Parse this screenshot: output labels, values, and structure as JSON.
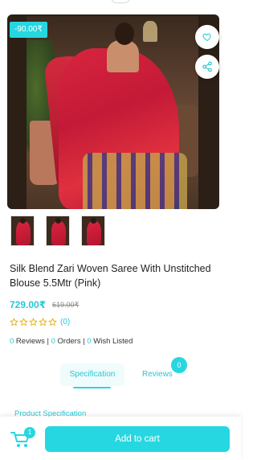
{
  "product": {
    "discount_badge": "-90.00₹",
    "title": "Silk Blend Zari Woven Saree With Unstitched Blouse 5.5Mtr (Pink)",
    "price": "729.00₹",
    "old_price": "619.00₹",
    "rating_stars": 0,
    "rating_max": 5,
    "review_count_label": "(0)",
    "image_carousel": {
      "dot_count": 3,
      "active_dot": 1
    },
    "thumbnails_count": 3
  },
  "stats": {
    "reviews_num": "0",
    "reviews_label": " Reviews | ",
    "orders_num": "0",
    "orders_label": " Orders | ",
    "wish_num": "0",
    "wish_label": " Wish Listed"
  },
  "tabs": {
    "specification": "Specification",
    "reviews": "Reviews",
    "reviews_badge": "0"
  },
  "section": {
    "product_specification": "Product Specification"
  },
  "bottom_bar": {
    "cart_badge": "1",
    "add_to_cart": "Add to cart"
  },
  "icons": {
    "wishlist": "heart-icon",
    "share": "share-icon",
    "cart": "cart-icon",
    "star": "star-outline-icon"
  },
  "colors": {
    "accent": "#26d7e1",
    "accent_text": "#26c8d4"
  }
}
